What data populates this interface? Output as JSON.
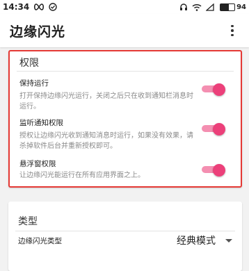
{
  "statusbar": {
    "time": "14:34",
    "battery": "94"
  },
  "appbar": {
    "title": "边缘闪光"
  },
  "permissions": {
    "title": "权限",
    "items": [
      {
        "title": "保持运行",
        "desc": "打开保持边缘闪光运行，关闭之后只在收到通知栏消息时运行。",
        "enabled": true
      },
      {
        "title": "监听通知权限",
        "desc": "授权让边缘闪光收到通知消息时运行，如果没有效果，请杀掉软件后台并重新授权即可。",
        "enabled": true
      },
      {
        "title": "悬浮窗权限",
        "desc": "让边缘闪光能运行在所有应用界面之上。",
        "enabled": true
      }
    ]
  },
  "type_section": {
    "title": "类型",
    "label": "边缘闪光类型",
    "value": "经典模式"
  },
  "colors": {
    "accent": "#ec407a",
    "accent_track": "#f48fb1",
    "highlight_border": "#e53935"
  }
}
